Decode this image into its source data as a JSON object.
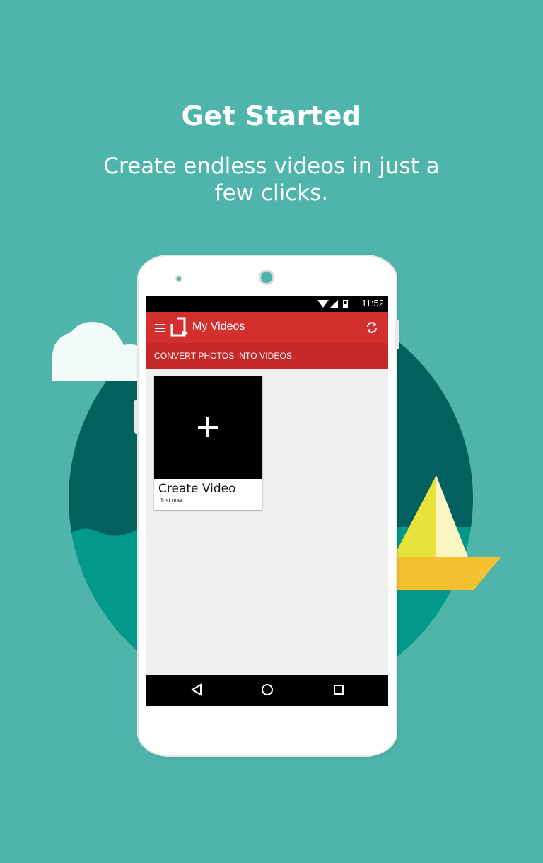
{
  "onboarding": {
    "title": "Get Started",
    "subtitle": "Create endless videos in just a few clicks."
  },
  "status_bar": {
    "time": "11:52",
    "icons": [
      "wifi-icon",
      "signal-icon",
      "battery-icon"
    ]
  },
  "toolbar": {
    "title": "My Videos",
    "menu_icon": "menu-icon",
    "logo_icon": "app-logo-icon",
    "refresh_icon": "refresh-icon"
  },
  "banner": {
    "text": "CONVERT PHOTOS INTO VIDEOS."
  },
  "video_card": {
    "title": "Create Video",
    "subtitle": "Just now",
    "icon": "plus-icon"
  },
  "nav_bar": {
    "buttons": [
      "back-icon",
      "home-icon",
      "recents-icon"
    ]
  },
  "colors": {
    "background": "#4fb5ab",
    "toolbar": "#d32f2f",
    "banner": "#c62828",
    "circle": "#02605f",
    "sea": "#02988a",
    "sail": "#e8e23a",
    "hull": "#f6c12f"
  }
}
